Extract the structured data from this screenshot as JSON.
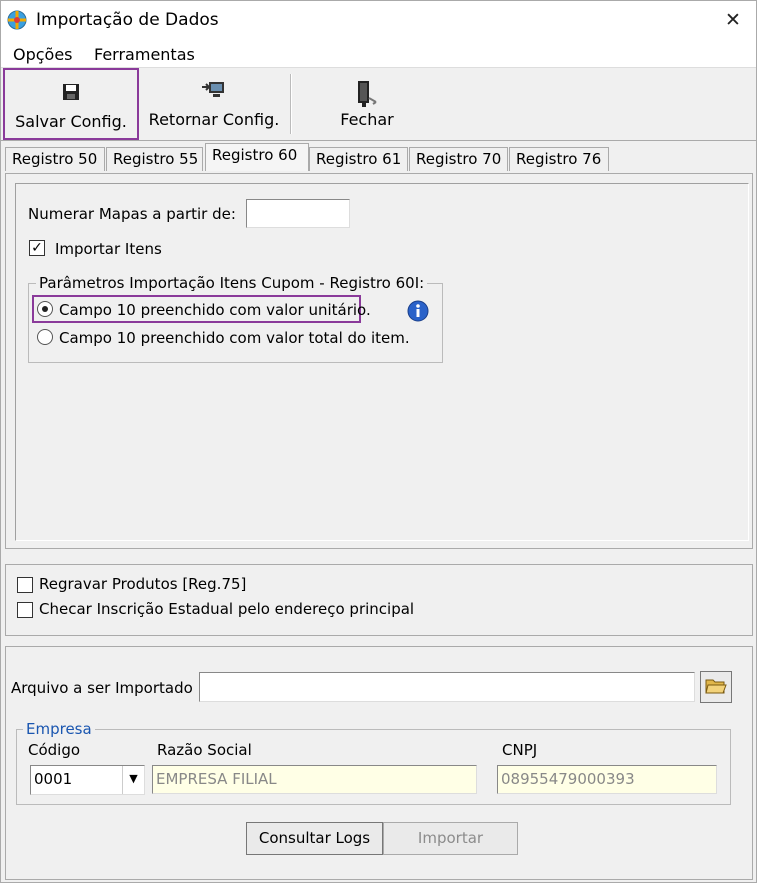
{
  "window": {
    "title": "Importação de Dados",
    "close_glyph": "✕"
  },
  "menu": [
    {
      "label": "Opções"
    },
    {
      "label": "Ferramentas"
    }
  ],
  "toolbar": {
    "save_label": "Salvar Config.",
    "restore_label": "Retornar Config.",
    "close_label": "Fechar"
  },
  "tabs": [
    {
      "label": "Registro 50"
    },
    {
      "label": "Registro 55"
    },
    {
      "label": "Registro 60"
    },
    {
      "label": "Registro 61"
    },
    {
      "label": "Registro 70"
    },
    {
      "label": "Registro 76"
    }
  ],
  "active_tab": "Registro 60",
  "reg60": {
    "numerar_label": "Numerar Mapas a partir de:",
    "numerar_value": "",
    "importar_itens_label": "Importar Itens",
    "importar_itens_checked": true,
    "group_label": "Parâmetros Importação Itens Cupom - Registro 60I:",
    "opt_unitario": "Campo 10 preenchido com valor unitário.",
    "opt_total": "Campo 10 preenchido com valor total do item.",
    "selected": "opt_unitario"
  },
  "options": {
    "regravar_label": "Regravar Produtos [Reg.75]",
    "regravar_checked": false,
    "checar_label": "Checar Inscrição Estadual pelo endereço principal",
    "checar_checked": false
  },
  "import": {
    "arquivo_label": "Arquivo a ser Importado",
    "arquivo_value": "",
    "empresa_legend": "Empresa",
    "codigo_label": "Código",
    "razao_label": "Razão Social",
    "cnpj_label": "CNPJ",
    "codigo_value": "0001",
    "razao_value": "EMPRESA FILIAL",
    "cnpj_value": "08955479000393"
  },
  "buttons": {
    "consultar": "Consultar Logs",
    "importar": "Importar"
  },
  "colors": {
    "highlight": "#8a3a9a",
    "readonly_bg": "#ffffe6",
    "info_blue": "#2a62c9"
  }
}
